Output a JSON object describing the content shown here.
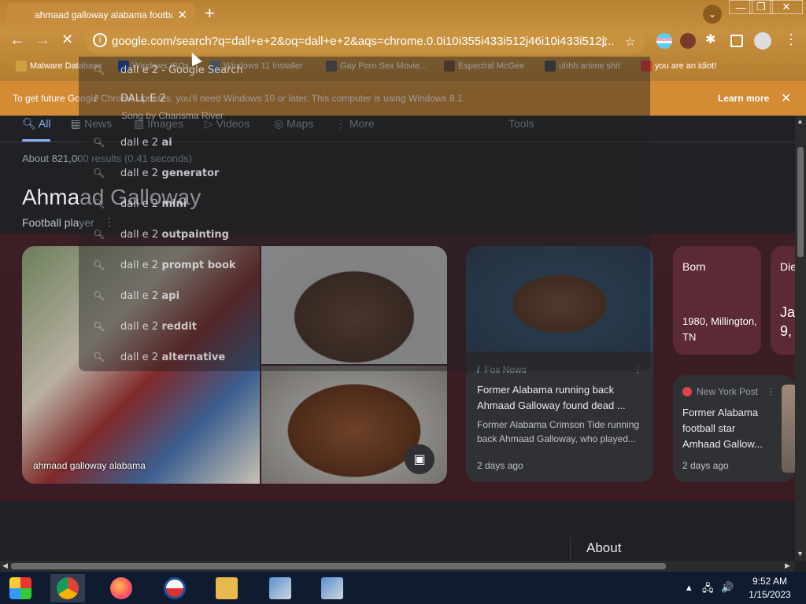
{
  "browser": {
    "tab_title": "ahmaad galloway alabama football",
    "tab_close": "✕",
    "new_tab": "+",
    "url": "google.com/search?q=dall+e+2&oq=dall+e+2&aqs=chrome.0.0i10i355i433i512j46i10i433i512j...",
    "win_min": "—",
    "win_restore": "❐",
    "win_close": "✕",
    "back": "←",
    "forward": "→",
    "reload": "✕",
    "share": "⇪",
    "star": "☆",
    "menu": "⋮",
    "tab_search": "⌄"
  },
  "bookmarks": [
    {
      "label": "Malware Database",
      "color": "#d0a040"
    },
    {
      "label": "Windows ISOs",
      "color": "#1a3fa8"
    },
    {
      "label": "Windows 11 Installer",
      "color": "#6a7b8a"
    },
    {
      "label": "Gay Porn Sex Movie...",
      "color": "#555"
    },
    {
      "label": "Espectral McGee",
      "color": "#6b4b2a"
    },
    {
      "label": "uhhh anime shit",
      "color": "#444"
    },
    {
      "label": "you are an idiot!",
      "color": "#d33"
    }
  ],
  "infobar": {
    "message": "To get future Google Chrome updates, you'll need Windows 10 or later. This computer is using Windows 8.1.",
    "learn_more": "Learn more",
    "close": "✕"
  },
  "suggestions": [
    {
      "prefix": "dall e 2",
      "suffix": " - Google Search"
    },
    {
      "prefix": "DALL·E 2",
      "suffix": ""
    },
    {
      "prefix": "dall e 2",
      "suffix": " ai"
    },
    {
      "prefix": "dall e 2",
      "suffix": " generator"
    },
    {
      "prefix": "dall e 2",
      "suffix": " mini"
    },
    {
      "prefix": "dall e 2",
      "suffix": " outpainting"
    },
    {
      "prefix": "dall e 2",
      "suffix": " prompt book"
    },
    {
      "prefix": "dall e 2",
      "suffix": " api"
    },
    {
      "prefix": "dall e 2",
      "suffix": " reddit"
    },
    {
      "prefix": "dall e 2",
      "suffix": " alternative"
    }
  ],
  "suggest_subline": "Song by Charisma River",
  "search": {
    "tabs": [
      "All",
      "News",
      "Images",
      "Videos",
      "Maps",
      "More"
    ],
    "tools": "Tools",
    "stats": "About 821,000 results (0.41 seconds)",
    "entity_title": "Ahmaad Galloway",
    "entity_subtitle": "Football player",
    "entity_more": "⋮",
    "image_caption": "ahmaad galloway alabama",
    "image_btn": "▣",
    "news": [
      {
        "source": "Fox News",
        "headline": "Former Alabama running back Ahmaad Galloway found dead ...",
        "desc": "Former Alabama Crimson Tide running back Ahmaad Galloway, who played...",
        "date": "2 days ago"
      },
      {
        "source": "New York Post",
        "headline": "Former Alabama football star Amhaad Gallow...",
        "date": "2 days ago"
      }
    ],
    "facts": [
      {
        "label": "Born",
        "value": "1980, Millington, TN"
      },
      {
        "label": "Die",
        "value": "Ja 9,"
      }
    ],
    "about": "About",
    "dots": "⋮"
  },
  "taskbar": {
    "time": "9:52 AM",
    "date": "1/15/2023",
    "tray_up": "▴",
    "tray_net": "🖧",
    "tray_vol": "🔊"
  },
  "colors": {
    "chrome_accent": "#c58d3d",
    "infobar": "#d38b34",
    "link_blue": "#8ab4f8",
    "page_bg": "#202124",
    "fact_card": "#5b2a34"
  }
}
